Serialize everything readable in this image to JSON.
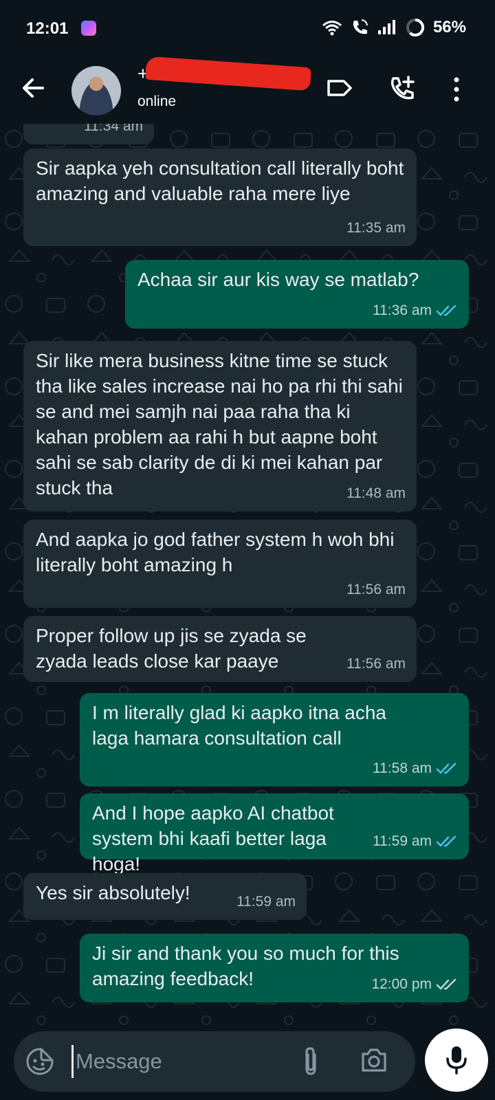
{
  "status_bar": {
    "time": "12:01",
    "battery": "56%"
  },
  "header": {
    "name": "+9…",
    "status": "online"
  },
  "messages": [
    {
      "text": "",
      "time": "11:34 am",
      "dir": "in"
    },
    {
      "text": "Sir aapka yeh consultation call literally boht amazing and valuable raha mere liye",
      "time": "11:35 am",
      "dir": "in"
    },
    {
      "text": "Achaa sir aur kis way se matlab?",
      "time": "11:36 am",
      "dir": "out",
      "ticks": "read"
    },
    {
      "text": "Sir like mera business kitne time se stuck tha like sales increase nai ho pa rhi thi sahi se and mei samjh nai paa raha tha ki kahan problem aa rahi h but aapne boht sahi se sab clarity de di ki mei kahan par stuck tha",
      "time": "11:48 am",
      "dir": "in"
    },
    {
      "text": "And aapka jo god father system h woh bhi literally boht amazing h",
      "time": "11:56 am",
      "dir": "in"
    },
    {
      "text": "Proper follow up jis se zyada se zyada leads close kar paaye",
      "time": "11:56 am",
      "dir": "in"
    },
    {
      "text": "I m literally glad ki aapko itna acha laga hamara consultation call",
      "time": "11:58 am",
      "dir": "out",
      "ticks": "read"
    },
    {
      "text": "And I hope aapko AI chatbot system bhi kaafi better laga hoga!",
      "time": "11:59 am",
      "dir": "out",
      "ticks": "read"
    },
    {
      "text": "Yes sir absolutely!",
      "time": "11:59 am",
      "dir": "in"
    },
    {
      "text": "Ji sir and thank you so much for this amazing feedback!",
      "time": "12:00 pm",
      "dir": "out",
      "ticks": "delivered"
    }
  ],
  "composer": {
    "placeholder": "Message"
  },
  "colors": {
    "background": "#0b141a",
    "incoming": "#202c33",
    "outgoing": "#005c4b",
    "read_tick": "#53bdeb",
    "delivered_tick": "#c4d6d0"
  }
}
